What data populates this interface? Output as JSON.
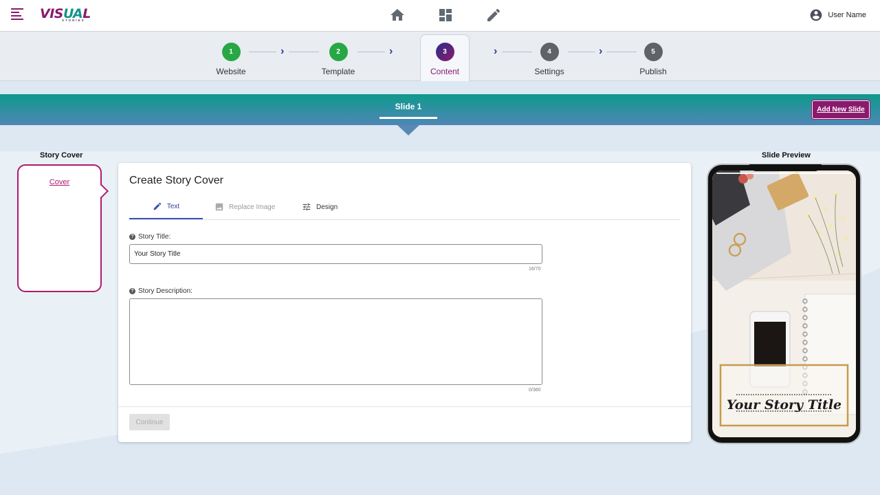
{
  "header": {
    "logo_main": "VISUAL",
    "logo_sub": "STORIES",
    "nav_icons": [
      "home-icon",
      "dashboard-icon",
      "edit-icon"
    ],
    "user_name": "User Name"
  },
  "stepper": {
    "steps": [
      {
        "number": "1",
        "label": "Website",
        "state": "done"
      },
      {
        "number": "2",
        "label": "Template",
        "state": "done"
      },
      {
        "number": "3",
        "label": "Content",
        "state": "active"
      },
      {
        "number": "4",
        "label": "Settings",
        "state": "todo"
      },
      {
        "number": "5",
        "label": "Publish",
        "state": "todo"
      }
    ],
    "chevron": "›"
  },
  "slides": {
    "tab_label": "Slide  1",
    "add_button": "Add New Slide"
  },
  "left_panel": {
    "title": "Story Cover",
    "cover_link": "Cover"
  },
  "editor": {
    "title": "Create Story Cover",
    "tabs": [
      {
        "label": "Text",
        "icon": "pencil-icon",
        "active": true
      },
      {
        "label": "Replace Image",
        "icon": "image-icon",
        "active": false
      },
      {
        "label": "Design",
        "icon": "sliders-icon",
        "active": false
      }
    ],
    "title_field": {
      "label": "Story Title:",
      "value": "Your Story Title",
      "counter": "16/70"
    },
    "description_field": {
      "label": "Story Description:",
      "value": "",
      "counter": "0/360"
    },
    "continue_label": "Continue"
  },
  "preview": {
    "title": "Slide Preview",
    "story_title": "Your Story Title"
  },
  "colors": {
    "brand_purple": "#8a1a6e",
    "brand_teal": "#14958a",
    "accent_blue": "#3a52b5",
    "success_green": "#28a745"
  }
}
